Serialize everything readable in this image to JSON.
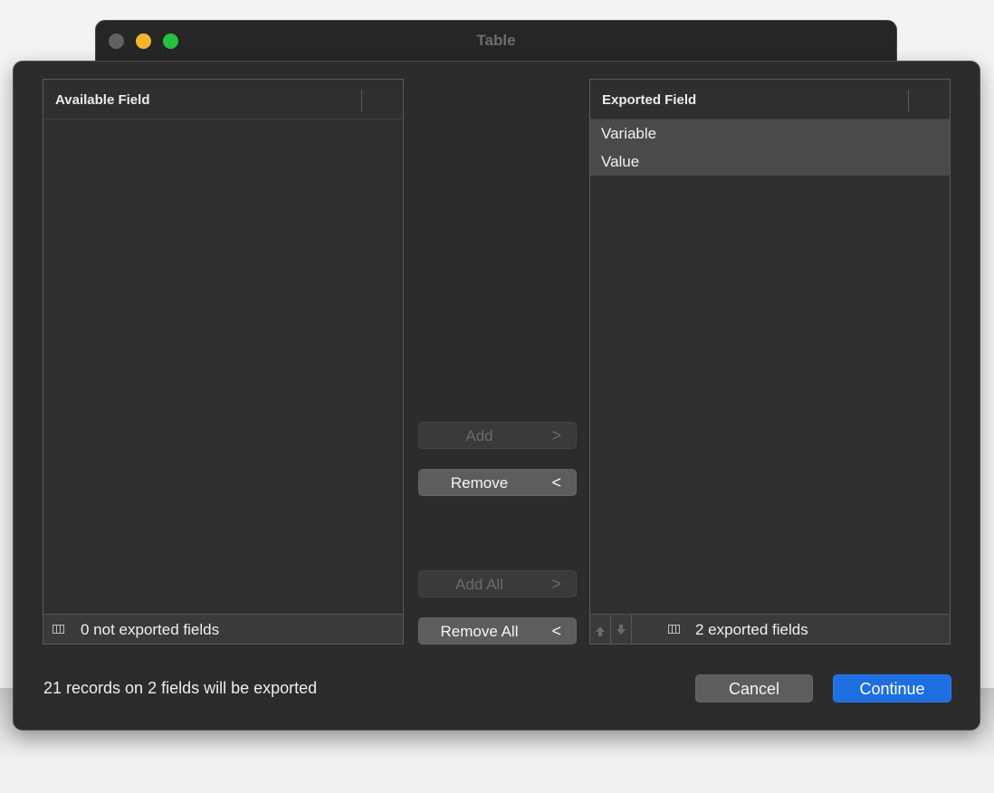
{
  "window": {
    "title": "Table"
  },
  "available": {
    "header": "Available Field",
    "items": [],
    "footer": "0 not exported fields"
  },
  "exported": {
    "header": "Exported Field",
    "items": [
      {
        "label": "Variable"
      },
      {
        "label": "Value"
      }
    ],
    "footer": "2 exported fields"
  },
  "buttons": {
    "add": "Add",
    "remove": "Remove",
    "add_all": "Add All",
    "remove_all": "Remove All",
    "chev_right": ">",
    "chev_left": "<",
    "cancel": "Cancel",
    "continue": "Continue"
  },
  "status": "21 records on 2 fields will be exported",
  "icons": {
    "close": "close-icon",
    "minimize": "minimize-icon",
    "maximize": "maximize-icon",
    "columns": "columns-icon",
    "move_up": "arrow-up-icon",
    "move_down": "arrow-down-icon"
  },
  "colors": {
    "accent": "#1e6fe0",
    "traffic_close_inactive": "#616161",
    "traffic_min": "#f5b52b",
    "traffic_max": "#27c13f"
  }
}
